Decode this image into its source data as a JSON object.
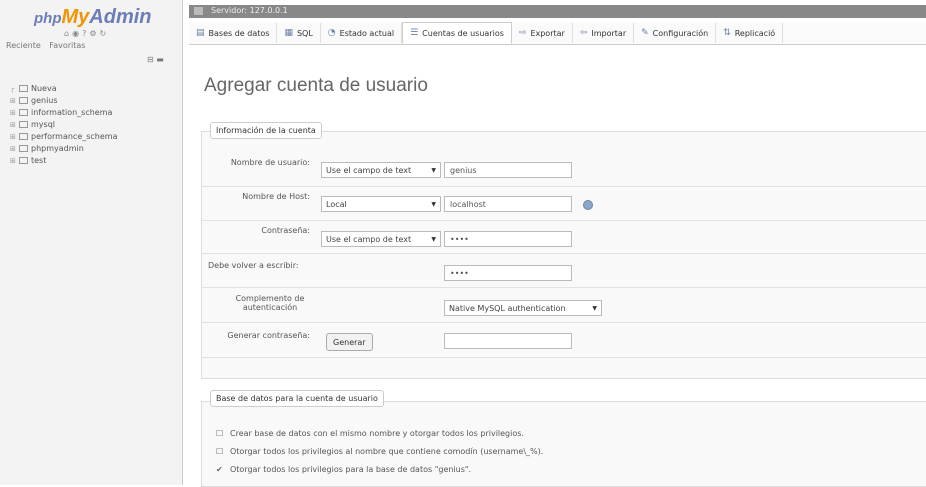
{
  "nav": {
    "logo": {
      "php": "php",
      "my": "My",
      "admin": "Admin"
    },
    "recent": "Reciente",
    "favorites": "Favoritas",
    "tree": [
      {
        "name": "Nueva"
      },
      {
        "name": "genius"
      },
      {
        "name": "information_schema"
      },
      {
        "name": "mysql"
      },
      {
        "name": "performance_schema"
      },
      {
        "name": "phpmyadmin"
      },
      {
        "name": "test"
      }
    ]
  },
  "server": "Servidor: 127.0.0.1",
  "tabs": [
    {
      "label": "Bases de datos",
      "icon": "database-icon"
    },
    {
      "label": "SQL",
      "icon": "sql-icon"
    },
    {
      "label": "Estado actual",
      "icon": "status-icon"
    },
    {
      "label": "Cuentas de usuarios",
      "icon": "users-icon",
      "active": true
    },
    {
      "label": "Exportar",
      "icon": "export-icon"
    },
    {
      "label": "Importar",
      "icon": "import-icon"
    },
    {
      "label": "Configuración",
      "icon": "settings-icon"
    },
    {
      "label": "Replicació",
      "icon": "replication-icon"
    }
  ],
  "page_title": "Agregar cuenta de usuario",
  "login": {
    "legend": "Información de la cuenta",
    "username_label": "Nombre de usuario:",
    "username_type": "Use el campo de text",
    "username_value": "genius",
    "host_label": "Nombre de Host:",
    "host_type": "Local",
    "host_value": "localhost",
    "password_label": "Contraseña:",
    "password_type": "Use el campo de text",
    "password_value": "••••",
    "retype_label": "Debe volver a escribir:",
    "retype_value": "••••",
    "auth_label": "Complemento de autenticación",
    "auth_value": "Native MySQL authentication",
    "generate_label": "Generar contraseña:",
    "generate_button": "Generar",
    "generate_value": ""
  },
  "database": {
    "legend": "Base de datos para la cuenta de usuario",
    "options": [
      {
        "label": "Crear base de datos con el mismo nombre y otorgar todos los privilegios.",
        "checked": false
      },
      {
        "label": "Otorgar todos los privilegios al nombre que contiene comodín (username\\_%).",
        "checked": false
      },
      {
        "label": "Otorgar todos los privilegios para la base de datos \"genius\".",
        "checked": true
      }
    ]
  }
}
